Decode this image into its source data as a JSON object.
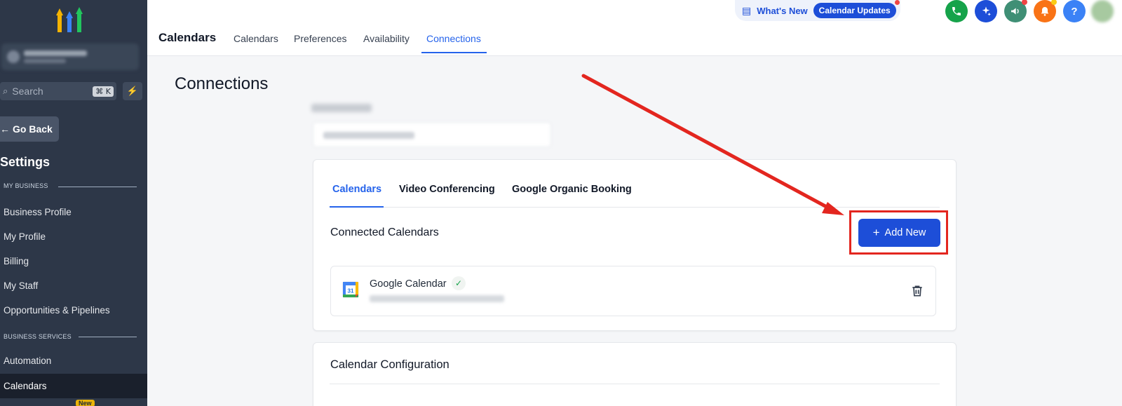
{
  "sidebar": {
    "search_placeholder": "Search",
    "search_shortcut": "⌘ K",
    "go_back": "Go Back",
    "settings_title": "Settings",
    "sections": {
      "my_business": "MY BUSINESS",
      "business_services": "BUSINESS SERVICES"
    },
    "items": [
      {
        "label": "Business Profile"
      },
      {
        "label": "My Profile"
      },
      {
        "label": "Billing"
      },
      {
        "label": "My Staff"
      },
      {
        "label": "Opportunities & Pipelines"
      },
      {
        "label": "Automation"
      },
      {
        "label": "Calendars"
      }
    ],
    "new_badge": "New"
  },
  "topbar": {
    "whats_new": "What's New",
    "calendar_updates": "Calendar Updates",
    "page_title": "Calendars",
    "tabs": [
      {
        "label": "Calendars"
      },
      {
        "label": "Preferences"
      },
      {
        "label": "Availability"
      },
      {
        "label": "Connections"
      }
    ],
    "icons": {
      "phone": "phone-icon",
      "sparkle": "sparkle-icon",
      "megaphone": "megaphone-icon",
      "bell": "bell-icon",
      "help": "?"
    },
    "colors": {
      "phone": "#16a34a",
      "sparkle": "#1d4ed8",
      "megaphone": "#3f8f75",
      "bell": "#f97316",
      "help": "#3b82f6"
    }
  },
  "main": {
    "title": "Connections",
    "card_tabs": [
      {
        "label": "Calendars"
      },
      {
        "label": "Video Conferencing"
      },
      {
        "label": "Google Organic Booking"
      }
    ],
    "connected_title": "Connected Calendars",
    "add_new": "Add New",
    "calendar": {
      "name": "Google Calendar",
      "icon_number": "31"
    },
    "config_title": "Calendar Configuration"
  }
}
